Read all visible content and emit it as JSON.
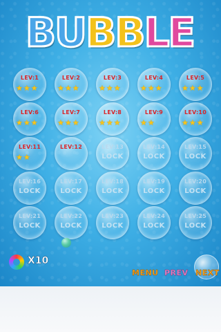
{
  "title": {
    "letters": [
      {
        "char": "B",
        "color": "#4aa5e8"
      },
      {
        "char": "U",
        "color": "#4aa5e8"
      },
      {
        "char": "B",
        "color": "#f3c21b"
      },
      {
        "char": "B",
        "color": "#f3c21b"
      },
      {
        "char": "L",
        "color": "#e0489e"
      },
      {
        "char": "E",
        "color": "#e0489e"
      }
    ]
  },
  "levels": [
    {
      "label": "LEV:1",
      "locked": false,
      "stars": "★★★"
    },
    {
      "label": "LEV:2",
      "locked": false,
      "stars": "★★★"
    },
    {
      "label": "LEV:3",
      "locked": false,
      "stars": "★★★"
    },
    {
      "label": "LEV:4",
      "locked": false,
      "stars": "★★★"
    },
    {
      "label": "LEV:5",
      "locked": false,
      "stars": "★★★"
    },
    {
      "label": "LEV:6",
      "locked": false,
      "stars": "★★★"
    },
    {
      "label": "LEV:7",
      "locked": false,
      "stars": "★★★"
    },
    {
      "label": "LEV:8",
      "locked": false,
      "stars": "★★★"
    },
    {
      "label": "LEV:9",
      "locked": false,
      "stars": "★★"
    },
    {
      "label": "LEV:10",
      "locked": false,
      "stars": "★★★"
    },
    {
      "label": "LEV:11",
      "locked": false,
      "stars": "★★"
    },
    {
      "label": "LEV:12",
      "locked": false,
      "stars": ""
    },
    {
      "label": "LEV:13",
      "locked": true,
      "stars": ""
    },
    {
      "label": "LEV:14",
      "locked": true,
      "stars": ""
    },
    {
      "label": "LEV:15",
      "locked": true,
      "stars": ""
    },
    {
      "label": "LEV:16",
      "locked": true,
      "stars": ""
    },
    {
      "label": "LEV:17",
      "locked": true,
      "stars": ""
    },
    {
      "label": "LEV:18",
      "locked": true,
      "stars": ""
    },
    {
      "label": "LEV:19",
      "locked": true,
      "stars": ""
    },
    {
      "label": "LEV:20",
      "locked": true,
      "stars": ""
    },
    {
      "label": "LEV:21",
      "locked": true,
      "stars": ""
    },
    {
      "label": "LEV:22",
      "locked": true,
      "stars": ""
    },
    {
      "label": "LEV:23",
      "locked": true,
      "stars": ""
    },
    {
      "label": "LEV:24",
      "locked": true,
      "stars": ""
    },
    {
      "label": "LEV:25",
      "locked": true,
      "stars": ""
    }
  ],
  "lock_text": "LOCK",
  "footer": {
    "ring_count": "X10",
    "menu_label": "MENU",
    "prev_label": "PREV",
    "next_label": "NEXT"
  },
  "icons": {
    "ring": "rainbow-ring-icon",
    "star": "star-icon"
  }
}
